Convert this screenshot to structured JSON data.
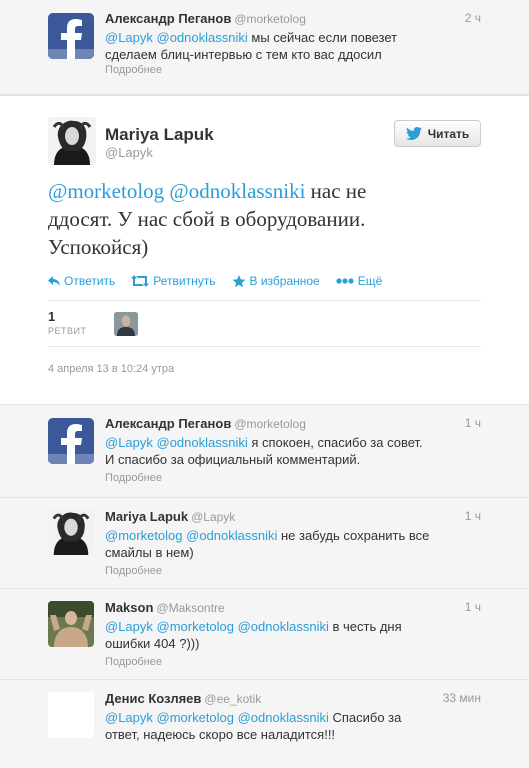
{
  "tweet_top": {
    "name": "Александр Пеганов",
    "handle": "@morketolog",
    "time": "2 ч",
    "mention1": "@Lapyk",
    "mention2": "@odnoklassniki",
    "text_line1_rest": " мы сейчас если повезет",
    "text_line2": "сделаем блиц-интервью с тем кто вас ддосил",
    "more": "Подробнее"
  },
  "main_tweet": {
    "name": "Mariya Lapuk",
    "handle": "@Lapyk",
    "follow_label": "Читать",
    "mention1": "@morketolog",
    "mention2": "@odnoklassniki",
    "text_line1_rest": " нас не",
    "text_line2": "ддосят. У нас сбой в оборудовании.",
    "text_line3": "Успокойся)",
    "actions": {
      "reply": "Ответить",
      "retweet": "Ретвитнуть",
      "favorite": "В избранное",
      "more": "Ещё"
    },
    "retweet_count": "1",
    "retweet_label": "РЕТВИТ",
    "date": "4 апреля 13 в 10:24 утра"
  },
  "replies": [
    {
      "name": "Александр Пеганов",
      "handle": "@morketolog",
      "time": "1 ч",
      "mentions": "@Lapyk @odnoklassniki",
      "text_rest": " я спокоен, спасибо за совет.",
      "text_line2": "И спасибо за официальный комментарий.",
      "more": "Подробнее"
    },
    {
      "name": "Mariya Lapuk",
      "handle": "@Lapyk",
      "time": "1 ч",
      "mentions": "@morketolog @odnoklassniki",
      "text_rest": " не забудь сохранить все",
      "text_line2": "смайлы в нем)",
      "more": "Подробнее"
    },
    {
      "name": "Makson",
      "handle": "@Maksontre",
      "time": "1 ч",
      "mentions": "@Lapyk @morketolog @odnoklassniki",
      "text_rest": " в честь дня",
      "text_line2": "ошибки 404 ?)))",
      "more": "Подробнее"
    },
    {
      "name": "Денис Козляев",
      "handle": "@ee_kotik",
      "time": "33 мин",
      "mentions": "@Lapyk @morketolog @odnoklassniki",
      "text_rest": " Спасибо за",
      "text_line2": "ответ, надеюсь скоро все наладится!!!",
      "more": ""
    }
  ],
  "colors": {
    "link": "#2a9ed8",
    "facebook": "#3b5998"
  }
}
